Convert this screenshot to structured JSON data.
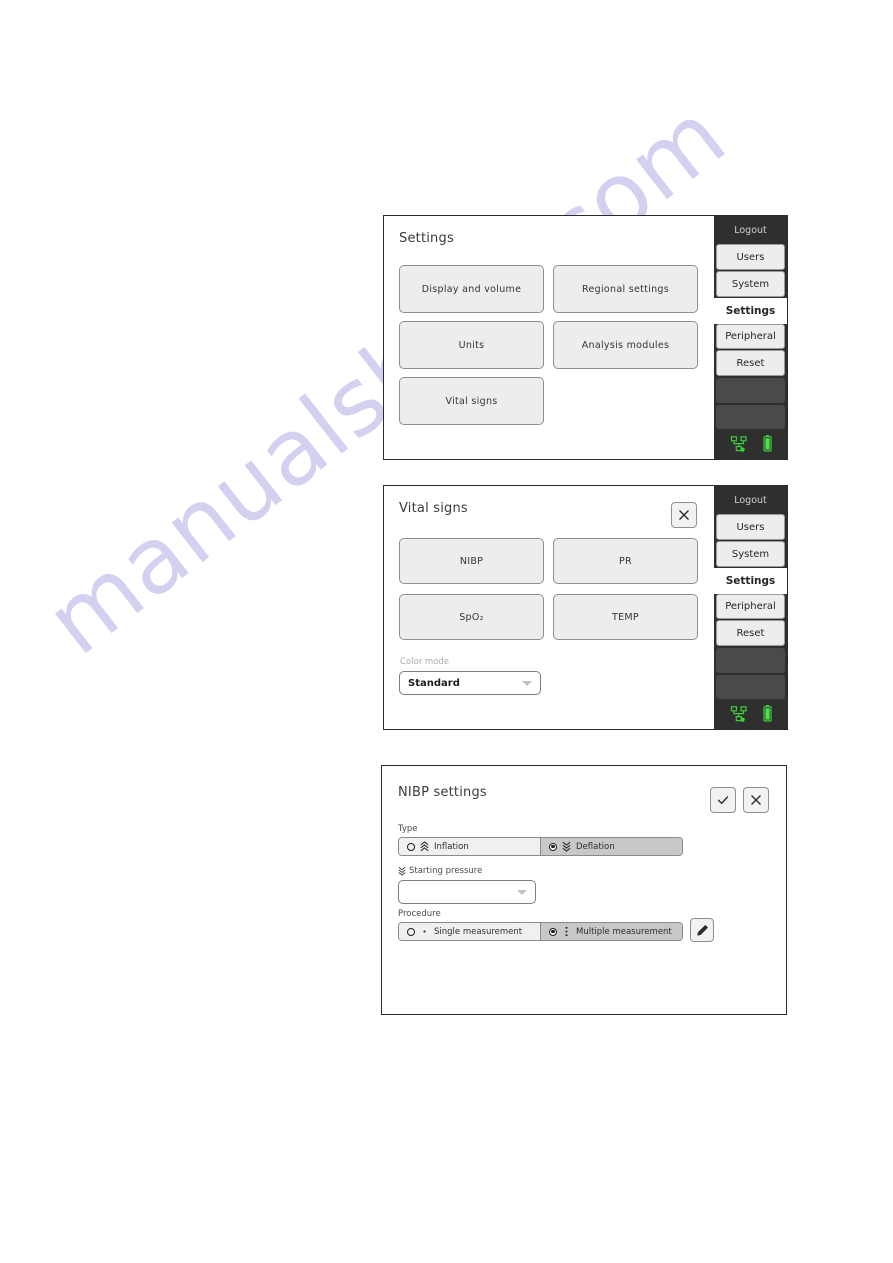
{
  "watermark": {
    "text": "manualshive.com"
  },
  "sidebar": {
    "logout_label": "Logout",
    "items": [
      {
        "label": "Users",
        "active": false
      },
      {
        "label": "System",
        "active": false
      },
      {
        "label": "Settings",
        "active": true
      },
      {
        "label": "Peripheral",
        "active": false
      },
      {
        "label": "Reset",
        "active": false
      }
    ],
    "blank_slots": 2,
    "status_icons": [
      {
        "name": "network-icon",
        "state": "connected",
        "color": "#3fcc3f"
      },
      {
        "name": "battery-icon",
        "state": "full",
        "color": "#3fcc3f"
      }
    ]
  },
  "panels": [
    {
      "id": "settings",
      "title": "Settings",
      "buttons": [
        {
          "label": "Display and volume"
        },
        {
          "label": "Regional settings"
        },
        {
          "label": "Units"
        },
        {
          "label": "Analysis modules"
        },
        {
          "label": "Vital signs"
        }
      ]
    },
    {
      "id": "vital-signs",
      "title": "Vital signs",
      "close_icon": "close-icon",
      "buttons": [
        {
          "label": "NIBP"
        },
        {
          "label": "PR"
        },
        {
          "label": "SpO₂"
        },
        {
          "label": "TEMP"
        }
      ],
      "color_mode": {
        "label": "Color mode",
        "value": "Standard"
      }
    },
    {
      "id": "nibp-settings",
      "title": "NIBP settings",
      "confirm_icon": "check-icon",
      "close_icon": "close-icon",
      "type": {
        "label": "Type",
        "options": [
          {
            "label": "Inflation",
            "icon": "chevrons-up-icon",
            "selected": false
          },
          {
            "label": "Deflation",
            "icon": "chevrons-down-icon",
            "selected": true
          }
        ]
      },
      "starting_pressure": {
        "label": "Starting pressure",
        "icon": "chevrons-down-icon",
        "value": ""
      },
      "procedure": {
        "label": "Procedure",
        "options": [
          {
            "label": "Single measurement",
            "icon": "single-dot-icon",
            "selected": false
          },
          {
            "label": "Multiple measurement",
            "icon": "three-dots-icon",
            "selected": true
          }
        ],
        "edit_icon": "pencil-icon"
      }
    }
  ]
}
